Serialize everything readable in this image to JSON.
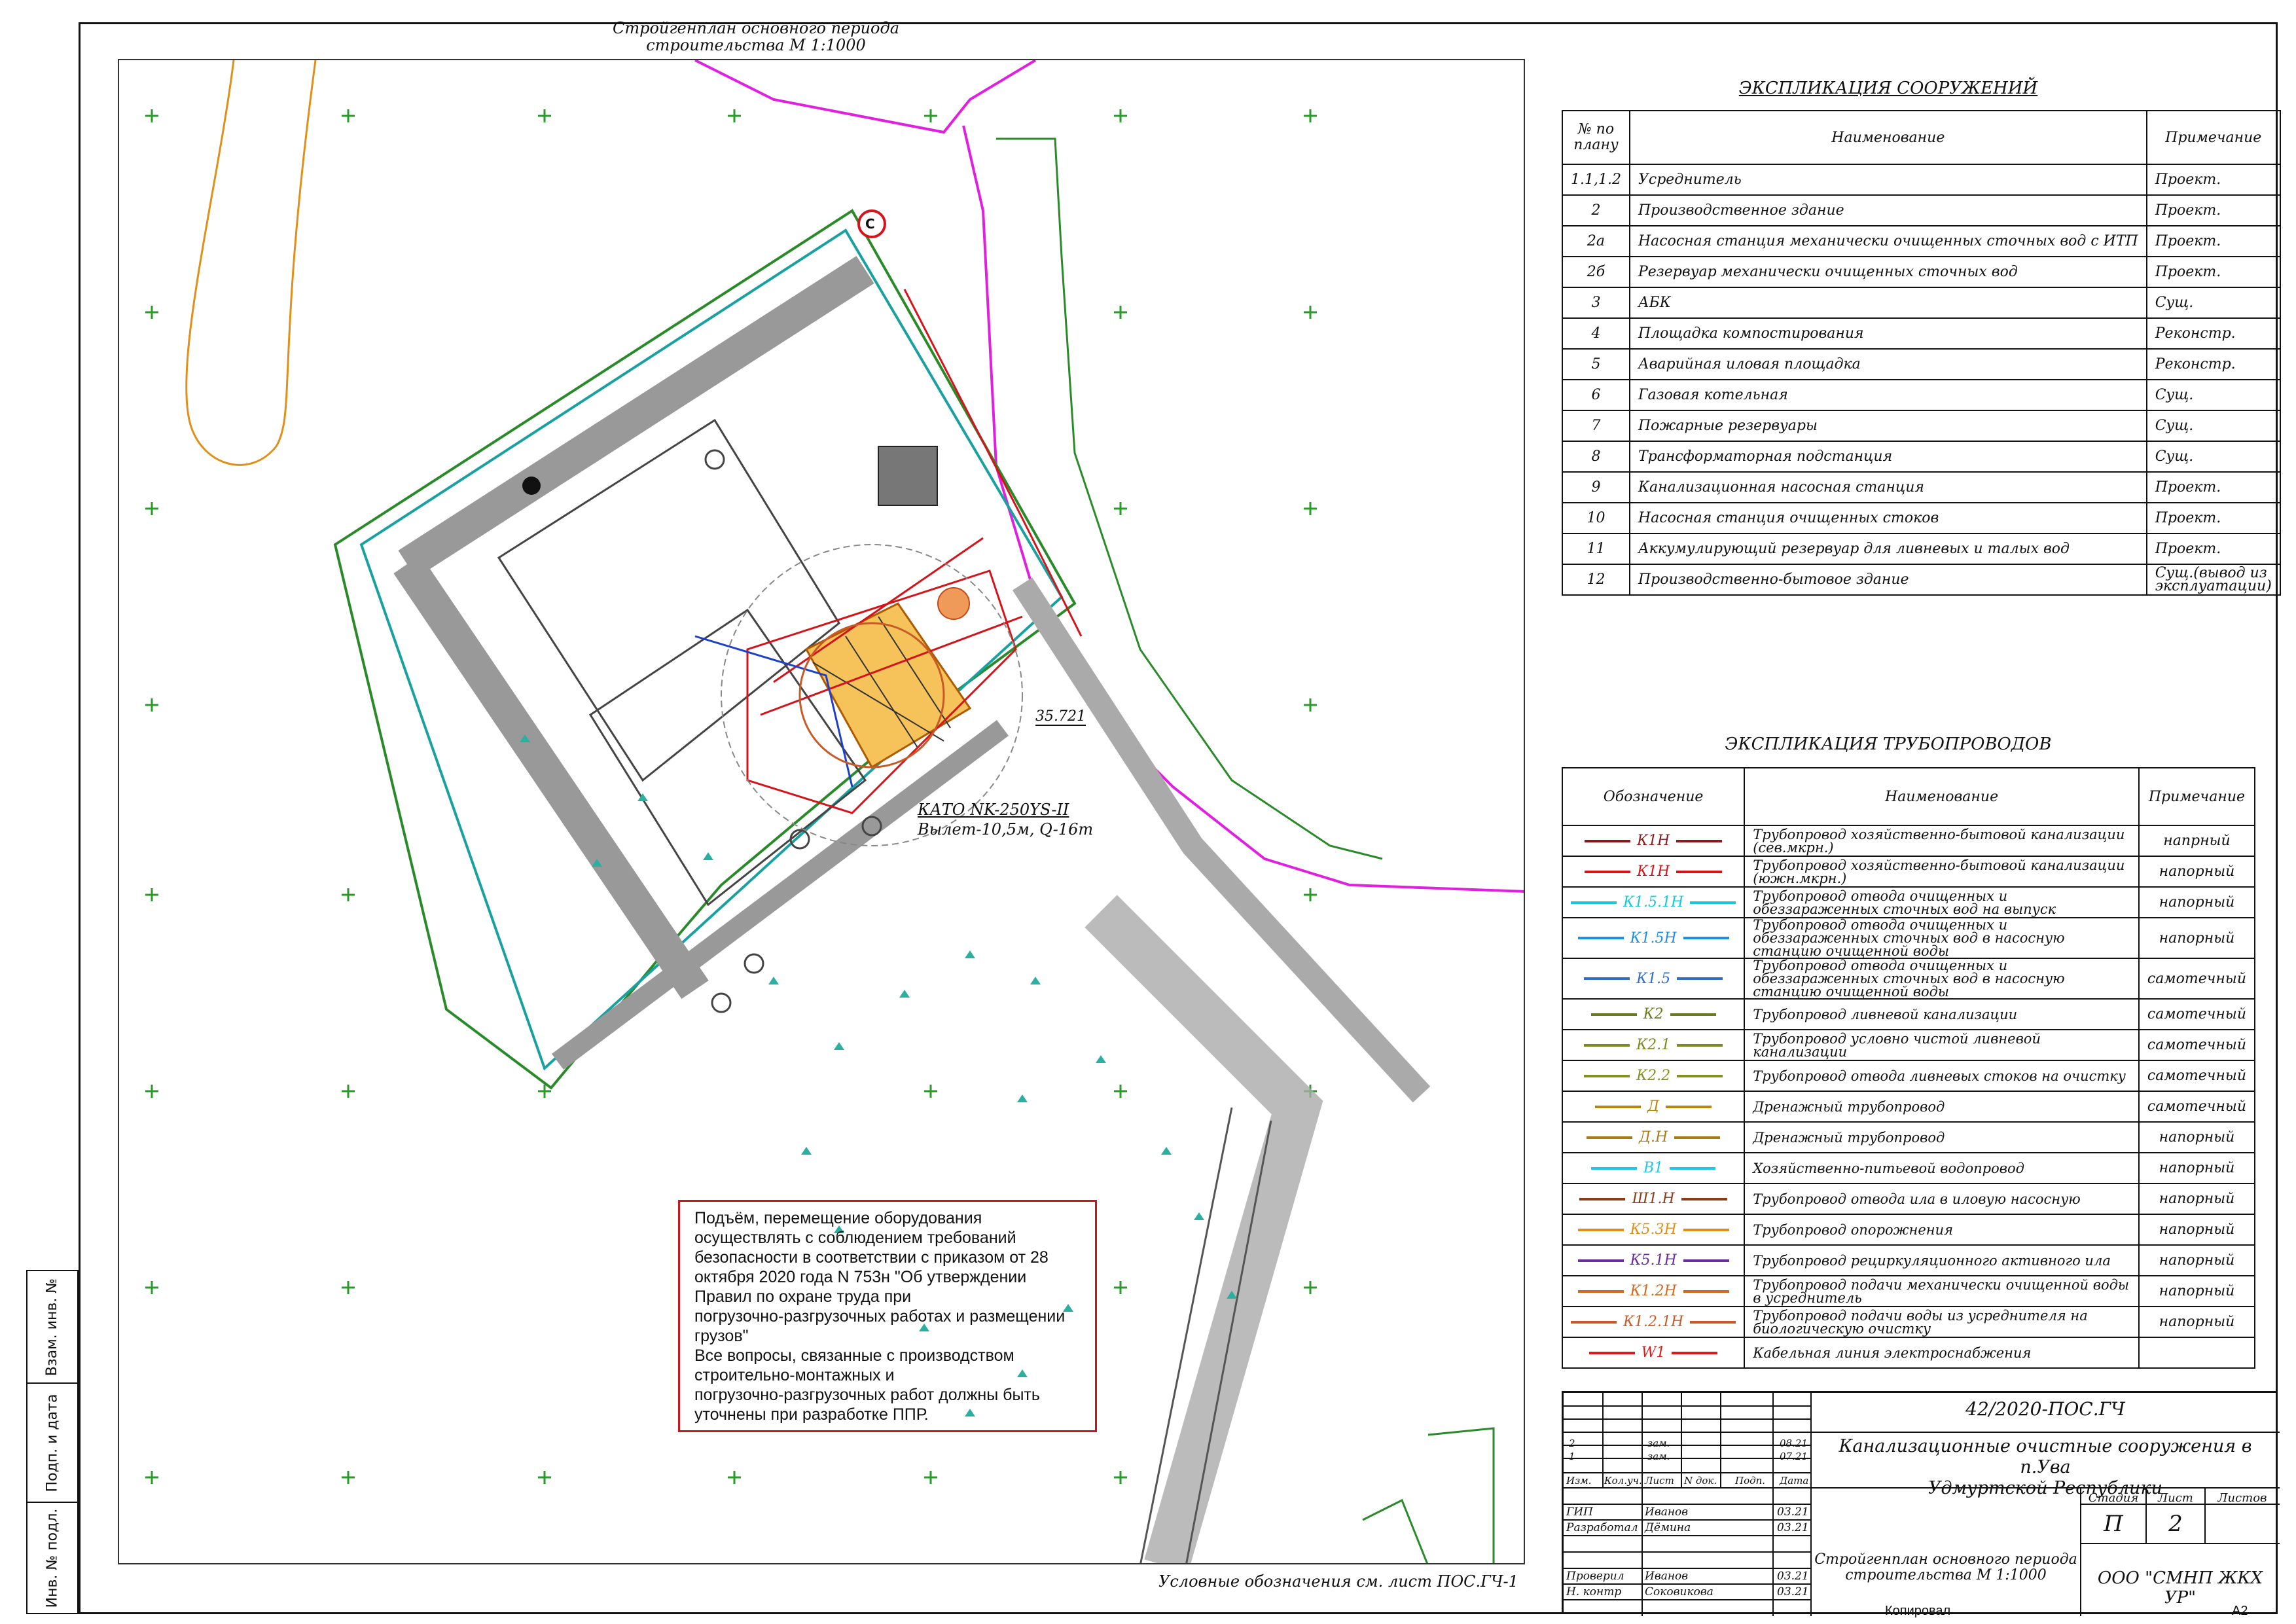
{
  "sheet": {
    "plan_title": [
      "Стройгенплан основного периода",
      "строительства М 1:1000"
    ],
    "legend_ref": "Условные обозначения см. лист ПОС.ГЧ-1",
    "crane_label": [
      "КАТО NK-250YS-II",
      "Вылет-10,5м, Q-16т"
    ],
    "north_marker": "С",
    "elevation_mark": "35.721",
    "footer_copy": "Копировал",
    "footer_format": "А2"
  },
  "side_stamp": [
    "Взам. инв. №",
    "Подп. и дата",
    "Инв. № подл."
  ],
  "note": {
    "lines": [
      "Подъём, перемещение оборудования",
      "осуществлять с соблюдением требований",
      "безопасности в соответствии с  приказом от 28",
      "октября 2020 года N 753н \"Об утверждении",
      "Правил по охране труда при",
      "погрузочно-разгрузочных работах и размещении",
      "грузов\"",
      "Все вопросы, связанные с производством",
      "строительно-монтажных и",
      "погрузочно-разгрузочных работ должны быть",
      "уточнены при разработке ППР."
    ]
  },
  "structures": {
    "title": "ЭКСПЛИКАЦИЯ СООРУЖЕНИЙ",
    "headers": [
      "№ по плану",
      "Наименование",
      "Примечание"
    ],
    "rows": [
      [
        "1.1,1.2",
        "Усреднитель",
        "Проект."
      ],
      [
        "2",
        "Производственное здание",
        "Проект."
      ],
      [
        "2а",
        "Насосная станция механически очищенных сточных вод с ИТП",
        "Проект."
      ],
      [
        "2б",
        "Резервуар механически очищенных сточных вод",
        "Проект."
      ],
      [
        "3",
        "АБК",
        "Сущ."
      ],
      [
        "4",
        "Площадка компостирования",
        "Реконстр."
      ],
      [
        "5",
        "Аварийная иловая площадка",
        "Реконстр."
      ],
      [
        "6",
        "Газовая котельная",
        "Сущ."
      ],
      [
        "7",
        "Пожарные резервуары",
        "Сущ."
      ],
      [
        "8",
        "Трансформаторная подстанция",
        "Сущ."
      ],
      [
        "9",
        "Канализационная насосная станция",
        "Проект."
      ],
      [
        "10",
        "Насосная станция очищенных стоков",
        "Проект."
      ],
      [
        "11",
        "Аккумулирующий резервуар для ливневых и талых вод",
        "Проект."
      ],
      [
        "12",
        "Производственно-бытовое здание",
        "Сущ.(вывод из эксплуатации)"
      ]
    ]
  },
  "pipes": {
    "title": "ЭКСПЛИКАЦИЯ ТРУБОПРОВОДОВ",
    "headers": [
      "Обозначение",
      "Наименование",
      "Примечание"
    ],
    "rows": [
      {
        "code": "К1Н",
        "color": "#8b1a1a",
        "name": "Трубопровод хозяйственно-бытовой канализации (сев.мкрн.)",
        "note": "напрный"
      },
      {
        "code": "К1Н",
        "color": "#d4141a",
        "name": "Трубопровод хозяйственно-бытовой канализации (южн.мкрн.)",
        "note": "напорный"
      },
      {
        "code": "К1.5.1Н",
        "color": "#18c7d8",
        "name": "Трубопровод отвода очищенных и обеззараженных сточных вод на выпуск",
        "note": "напорный"
      },
      {
        "code": "К1.5Н",
        "color": "#1e8fe0",
        "name": "Трубопровод отвода очищенных и обеззараженных сточных вод в насосную станцию очищенной воды",
        "note": "напорный"
      },
      {
        "code": "К1.5",
        "color": "#2c6fc4",
        "name": "Трубопровод отвода очищенных и обеззараженных сточных вод в насосную станцию очищенной воды",
        "note": "самотечный"
      },
      {
        "code": "К2",
        "color": "#6b7a1e",
        "name": "Трубопровод ливневой канализации",
        "note": "самотечный"
      },
      {
        "code": "К2.1",
        "color": "#7d8a1f",
        "name": "Трубопровод условно чистой ливневой канализации",
        "note": "самотечный"
      },
      {
        "code": "К2.2",
        "color": "#86901f",
        "name": "Трубопровод отвода ливневых стоков на очистку",
        "note": "самотечный"
      },
      {
        "code": "Д",
        "color": "#b8860b",
        "name": "Дренажный трубопровод",
        "note": "самотечный"
      },
      {
        "code": "Д.Н",
        "color": "#a67c1a",
        "name": "Дренажный трубопровод",
        "note": "напорный"
      },
      {
        "code": "В1",
        "color": "#1ec8e8",
        "name": "Хозяйственно-питьевой водопровод",
        "note": "напорный"
      },
      {
        "code": "Ш1.Н",
        "color": "#8b3a1a",
        "name": "Трубопровод отвода ила в иловую насосную",
        "note": "напорный"
      },
      {
        "code": "К5.3Н",
        "color": "#e0901a",
        "name": "Трубопровод опорожнения",
        "note": "напорный"
      },
      {
        "code": "К5.1Н",
        "color": "#6a2ca0",
        "name": "Трубопровод рециркуляционного активного ила",
        "note": "напорный"
      },
      {
        "code": "К1.2Н",
        "color": "#d2691e",
        "name": "Трубопровод подачи механически очищенной воды в усреднитель",
        "note": "напорный"
      },
      {
        "code": "К1.2.1Н",
        "color": "#c85a28",
        "name": "Трубопровод подачи воды из усреднителя на биологическую очистку",
        "note": "напорный"
      },
      {
        "code": "W1",
        "color": "#e01818",
        "name": "Кабельная линия электроснабжения",
        "note": ""
      }
    ]
  },
  "stamp": {
    "doc_code": "42/2020-ПОС.ГЧ",
    "project": [
      "Канализационные очистные сооружения в п.Ува",
      "Удмуртской Республики"
    ],
    "changes": [
      {
        "num": "2",
        "lst": "зам.",
        "date": "08.21"
      },
      {
        "num": "1",
        "lst": "зам.",
        "date": "07.21"
      }
    ],
    "change_headers": [
      "Изм.",
      "Кол.уч.",
      "Лист",
      "N док.",
      "Подп.",
      "Дата"
    ],
    "people": [
      {
        "role": "ГИП",
        "name": "Иванов",
        "date": "03.21"
      },
      {
        "role": "Разработал",
        "name": "Дёмина",
        "date": "03.21"
      },
      {
        "role": "Проверил",
        "name": "Иванов",
        "date": "03.21"
      },
      {
        "role": "Н. контр",
        "name": "Соковикова",
        "date": "03.21"
      }
    ],
    "sheet_title": [
      "Стройгенплан основного периода",
      "строительства М 1:1000"
    ],
    "stage_label": "Стадия",
    "sheet_label": "Лист",
    "sheets_label": "Листов",
    "stage": "П",
    "sheet_num": "2",
    "company": "ООО \"СМНП ЖКХ УР\""
  }
}
